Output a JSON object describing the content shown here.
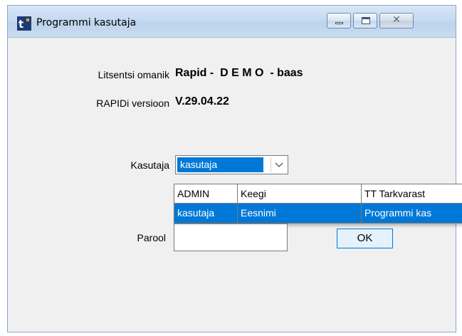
{
  "window": {
    "title": "Programmi kasutaja",
    "controls": {
      "minimize": "minimize-icon",
      "maximize": "maximize-icon",
      "close": "close-icon"
    }
  },
  "info": {
    "owner_label": "Litsentsi omanik",
    "owner_value": "Rapid -  D E M O  - baas",
    "version_label": "RAPIDi versioon",
    "version_value": "V.29.04.22"
  },
  "user": {
    "label": "Kasutaja",
    "selected": "kasutaja",
    "options": [
      [
        "ADMIN",
        "Keegi",
        "TT Tarkvarast"
      ],
      [
        "kasutaja",
        "Eesnimi",
        "Programmi kas"
      ]
    ]
  },
  "password": {
    "label": "Parool",
    "value": ""
  },
  "ok_label": "OK",
  "colors": {
    "accent": "#0078d7",
    "window_bg": "#f0f0f0"
  }
}
